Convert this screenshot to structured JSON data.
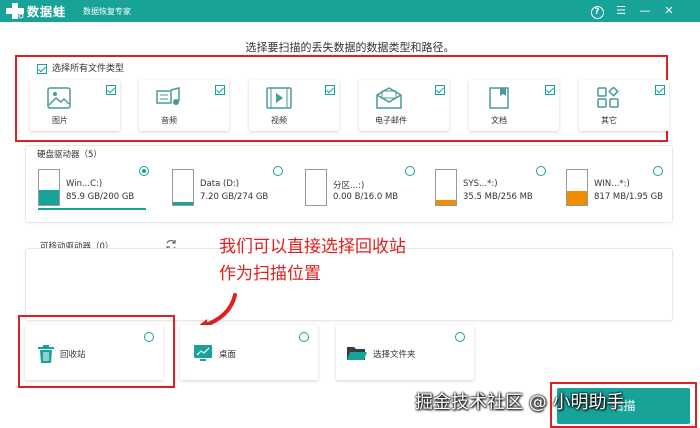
{
  "app": {
    "name": "数据蛙",
    "subtitle": "数据恢复专家",
    "accent_color": "#18a398",
    "highlight_color": "#e02020"
  },
  "titlebar_icons": [
    "help-icon",
    "menu-icon",
    "minimize-icon",
    "close-icon"
  ],
  "instruction": "选择要扫描的丢失数据的数据类型和路径。",
  "file_types": {
    "select_all_label": "选择所有文件类型",
    "items": [
      {
        "label": "图片",
        "icon": "image-icon",
        "checked": true
      },
      {
        "label": "音频",
        "icon": "audio-icon",
        "checked": true
      },
      {
        "label": "视频",
        "icon": "video-icon",
        "checked": true
      },
      {
        "label": "电子邮件",
        "icon": "email-icon",
        "checked": true
      },
      {
        "label": "文档",
        "icon": "document-icon",
        "checked": true
      },
      {
        "label": "其它",
        "icon": "other-icon",
        "checked": true
      }
    ]
  },
  "hard_drives": {
    "title": "硬盘驱动器（5）",
    "items": [
      {
        "name": "Win...C:)",
        "size": "85.9 GB/200 GB",
        "used_fraction": 0.43,
        "color": "#18a398",
        "selected": true
      },
      {
        "name": "Data (D:)",
        "size": "7.20 GB/274 GB",
        "used_fraction": 0.03,
        "color": "#18a398",
        "selected": false
      },
      {
        "name": "分区...:)",
        "size": "0.00  B/16.0 MB",
        "used_fraction": 0.0,
        "color": "#18a398",
        "selected": false
      },
      {
        "name": "SYS...*:)",
        "size": "35.5 MB/256 MB",
        "used_fraction": 0.14,
        "color": "#f08c00",
        "selected": false
      },
      {
        "name": "WIN...*:)",
        "size": "817 MB/1.95 GB",
        "used_fraction": 0.41,
        "color": "#f08c00",
        "selected": false
      }
    ]
  },
  "removable": {
    "title": "可移动驱动器（0）"
  },
  "annotation": {
    "line1": "我们可以直接选择回收站",
    "line2": "作为扫描位置"
  },
  "locations": [
    {
      "label": "回收站",
      "icon": "recycle-bin-icon"
    },
    {
      "label": "桌面",
      "icon": "desktop-icon"
    },
    {
      "label": "选择文件夹",
      "icon": "folder-icon"
    }
  ],
  "watermark": "掘金技术社区 @ 小明助手",
  "scan_button_label": "扫描"
}
